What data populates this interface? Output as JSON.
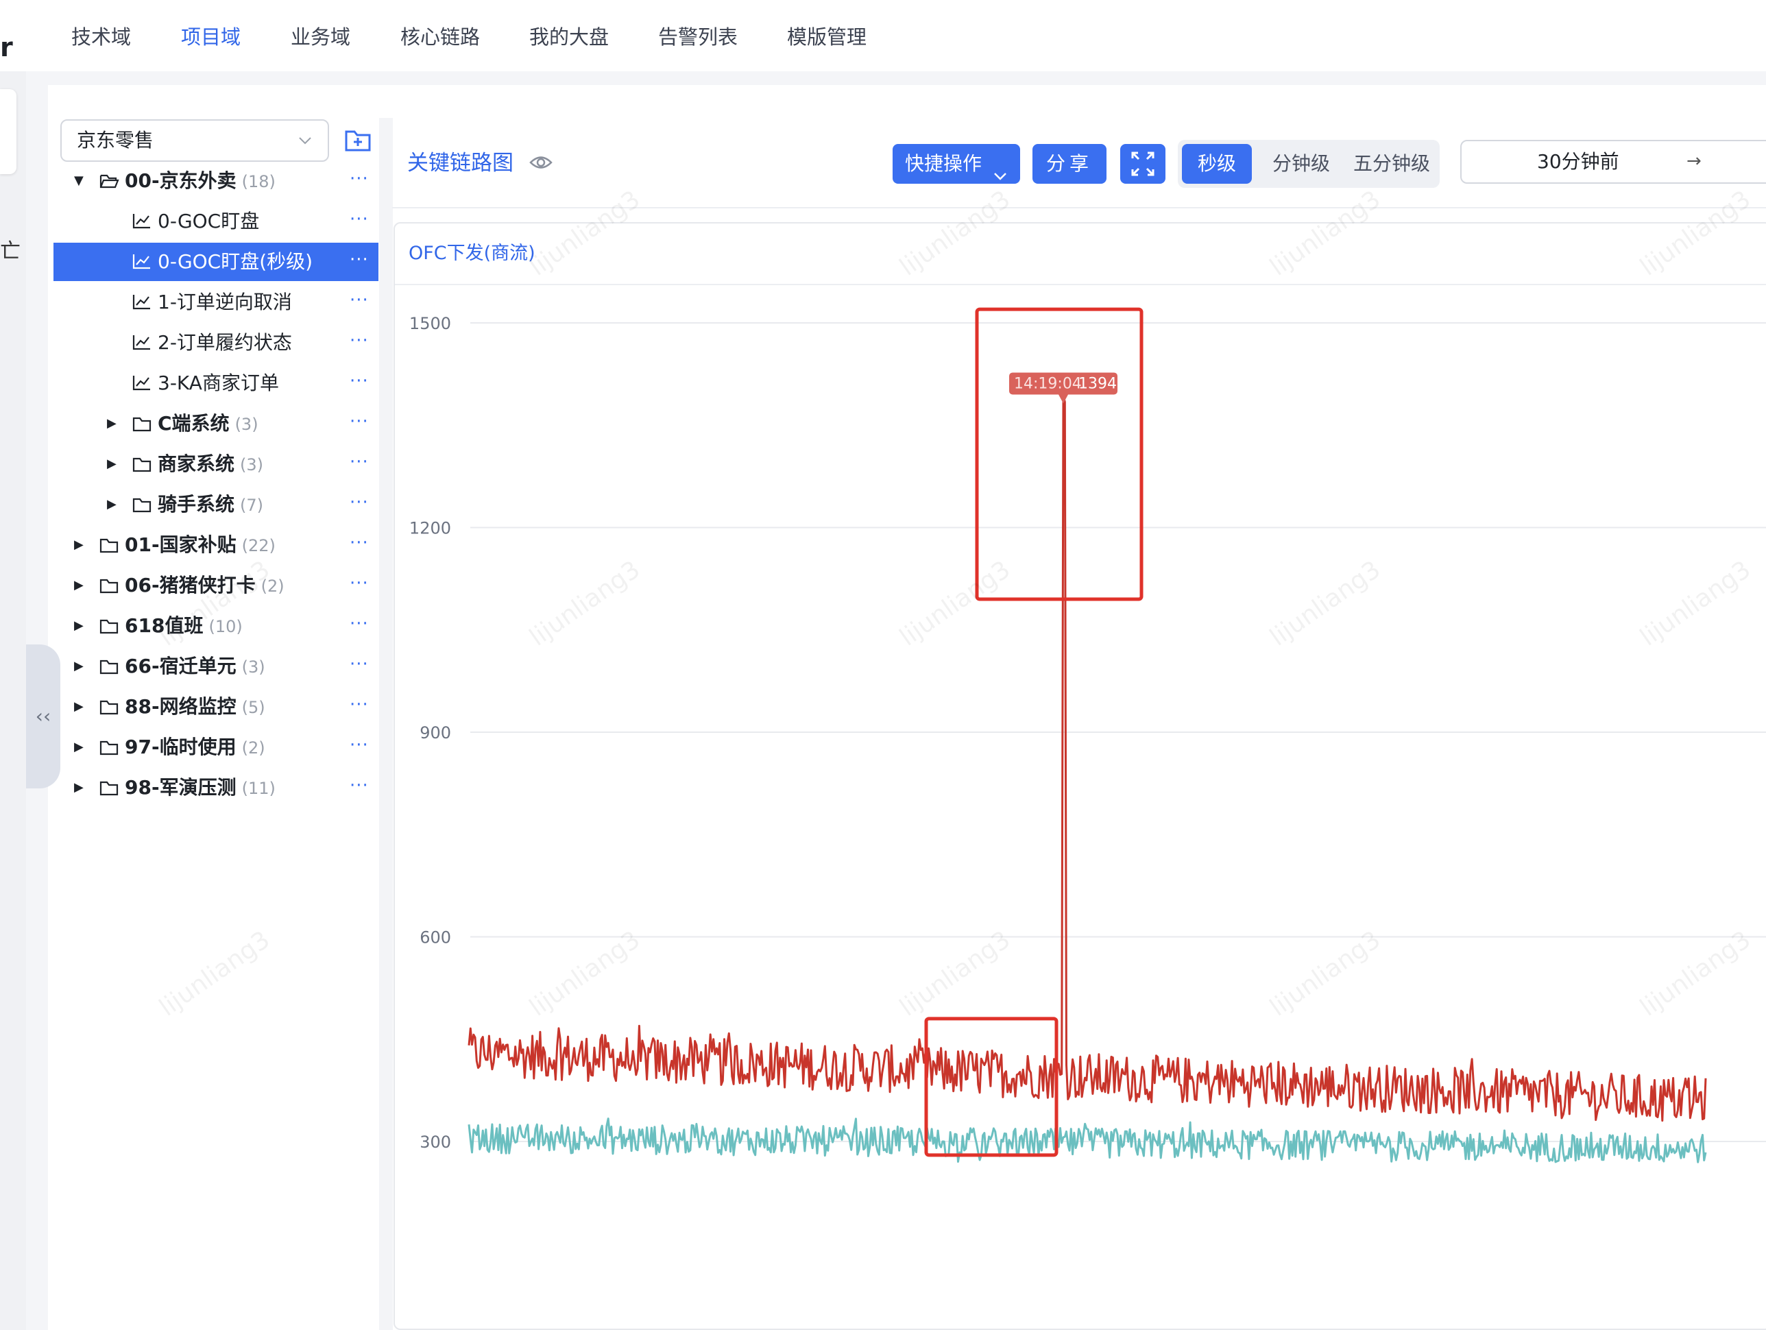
{
  "brand_fragment": "r",
  "rail_glyph": "亡",
  "nav": [
    "技术域",
    "项目域",
    "业务域",
    "核心链路",
    "我的大盘",
    "告警列表",
    "模版管理"
  ],
  "nav_active_index": 1,
  "tree": {
    "select_value": "京东零售",
    "rows": [
      {
        "label": "00-京东外卖",
        "count": "(18)",
        "type": "folder-open",
        "level": 0,
        "caret": "▼",
        "bold": true
      },
      {
        "label": "0-GOC盯盘",
        "count": "",
        "type": "chart",
        "level": 2,
        "caret": "",
        "bold": false
      },
      {
        "label": "0-GOC盯盘(秒级)",
        "count": "",
        "type": "chart",
        "level": 2,
        "caret": "",
        "bold": false,
        "selected": true
      },
      {
        "label": "1-订单逆向取消",
        "count": "",
        "type": "chart",
        "level": 2,
        "caret": "",
        "bold": false
      },
      {
        "label": "2-订单履约状态",
        "count": "",
        "type": "chart",
        "level": 2,
        "caret": "",
        "bold": false
      },
      {
        "label": "3-KA商家订单",
        "count": "",
        "type": "chart",
        "level": 2,
        "caret": "",
        "bold": false
      },
      {
        "label": "C端系统",
        "count": "(3)",
        "type": "folder",
        "level": 1,
        "caret": "▶",
        "bold": true
      },
      {
        "label": "商家系统",
        "count": "(3)",
        "type": "folder",
        "level": 1,
        "caret": "▶",
        "bold": true
      },
      {
        "label": "骑手系统",
        "count": "(7)",
        "type": "folder",
        "level": 1,
        "caret": "▶",
        "bold": true
      },
      {
        "label": "01-国家补贴",
        "count": "(22)",
        "type": "folder",
        "level": 0,
        "caret": "▶",
        "bold": true
      },
      {
        "label": "06-猪猪侠打卡",
        "count": "(2)",
        "type": "folder",
        "level": 0,
        "caret": "▶",
        "bold": true
      },
      {
        "label": "618值班",
        "count": "(10)",
        "type": "folder",
        "level": 0,
        "caret": "▶",
        "bold": true
      },
      {
        "label": "66-宿迁单元",
        "count": "(3)",
        "type": "folder",
        "level": 0,
        "caret": "▶",
        "bold": true
      },
      {
        "label": "88-网络监控",
        "count": "(5)",
        "type": "folder",
        "level": 0,
        "caret": "▶",
        "bold": true
      },
      {
        "label": "97-临时使用",
        "count": "(2)",
        "type": "folder",
        "level": 0,
        "caret": "▶",
        "bold": true
      },
      {
        "label": "98-军演压测",
        "count": "(11)",
        "type": "folder",
        "level": 0,
        "caret": "▶",
        "bold": true
      }
    ],
    "more_label": "···"
  },
  "content": {
    "title": "关键链路图",
    "quick_ops_label": "快捷操作",
    "share_label": "分享",
    "granularity": [
      "秒级",
      "分钟级",
      "五分钟级"
    ],
    "granularity_active": 0,
    "time_range": "30分钟前",
    "time_arrow": "→"
  },
  "watermark": "lijunliang3",
  "colors": {
    "accent": "#3a6ff0",
    "series_red": "#c8352b",
    "series_teal": "#6bbfc0",
    "highlight": "#e0322a"
  },
  "chart_data": {
    "type": "line",
    "title": "OFC下发(商流)",
    "xlabel": "",
    "ylabel": "",
    "ylim": [
      100,
      1500
    ],
    "yticks": [
      1500,
      1200,
      900,
      600,
      300
    ],
    "grid": true,
    "series": [
      {
        "color": "#c8352b",
        "start": 430,
        "end": 360,
        "noise": 35,
        "spike": {
          "at": 0.48,
          "value": 1394
        }
      },
      {
        "color": "#6bbfc0",
        "start": 305,
        "end": 290,
        "noise": 22
      }
    ],
    "tooltip": {
      "time": "14:19:04",
      "value": "1394"
    },
    "highlights": [
      "spike-peak",
      "dip-window"
    ]
  }
}
